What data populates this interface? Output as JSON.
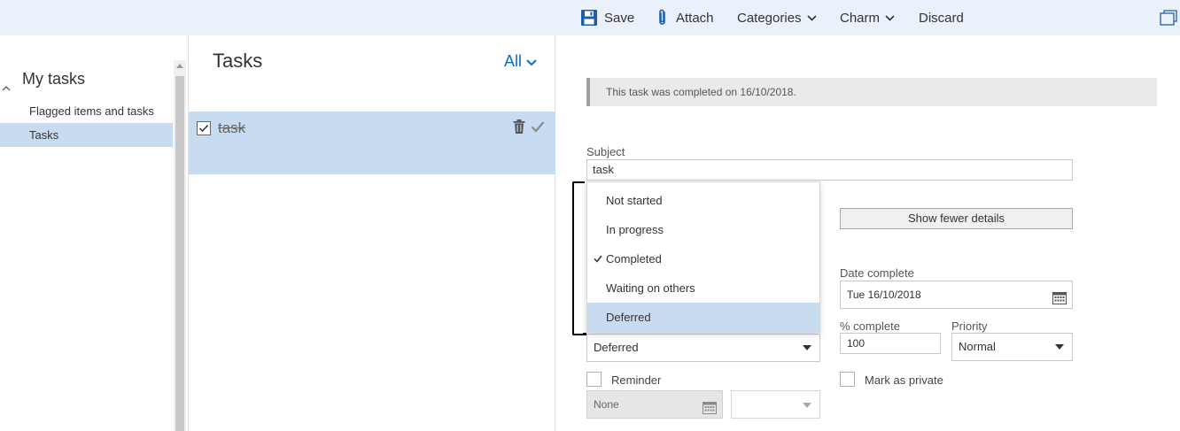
{
  "toolbar": {
    "save_label": "Save",
    "attach_label": "Attach",
    "categories_label": "Categories",
    "charm_label": "Charm",
    "discard_label": "Discard"
  },
  "nav": {
    "section_title": "My tasks",
    "items": [
      {
        "label": "Flagged items and tasks",
        "selected": false
      },
      {
        "label": "Tasks",
        "selected": true
      }
    ]
  },
  "list": {
    "title": "Tasks",
    "filter_label": "All",
    "tasks": [
      {
        "name": "task",
        "completed": true,
        "selected": true
      }
    ]
  },
  "details": {
    "banner_text": "This task was completed on 16/10/2018.",
    "subject_label": "Subject",
    "subject_value": "task",
    "status_options": [
      "Not started",
      "In progress",
      "Completed",
      "Waiting on others",
      "Deferred"
    ],
    "status_checked": "Completed",
    "status_hover": "Deferred",
    "status_value": "Deferred",
    "show_fewer_label": "Show fewer details",
    "date_complete_label": "Date complete",
    "date_complete_value": "Tue 16/10/2018",
    "percent_complete_label": "% complete",
    "percent_complete_value": "100",
    "priority_label": "Priority",
    "priority_value": "Normal",
    "reminder_label": "Reminder",
    "reminder_checked": false,
    "reminder_date_value": "None",
    "mark_private_label": "Mark as private",
    "mark_private_checked": false
  },
  "colors": {
    "accent": "#0f6cbd",
    "selection": "#c7dcf0",
    "toolbar_bg": "#eaf1fb",
    "save_icon": "#1e5ea8",
    "attach_icon": "#1e5ea8"
  },
  "icons": [
    "save-icon",
    "paperclip-icon",
    "chevron-down-icon",
    "popout-icon",
    "collapse-caret-icon",
    "checkbox-checked-icon",
    "trash-icon",
    "checkmark-icon",
    "calendar-icon",
    "check-icon"
  ]
}
